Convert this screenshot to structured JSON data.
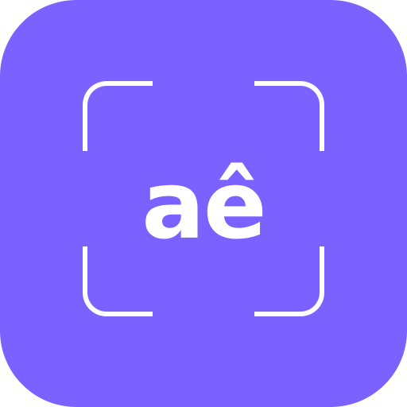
{
  "icon": {
    "text": "aê",
    "background_color": "#7B61FF",
    "foreground_color": "#FFFFFF",
    "frame_icon": "scan-frame-icon"
  }
}
